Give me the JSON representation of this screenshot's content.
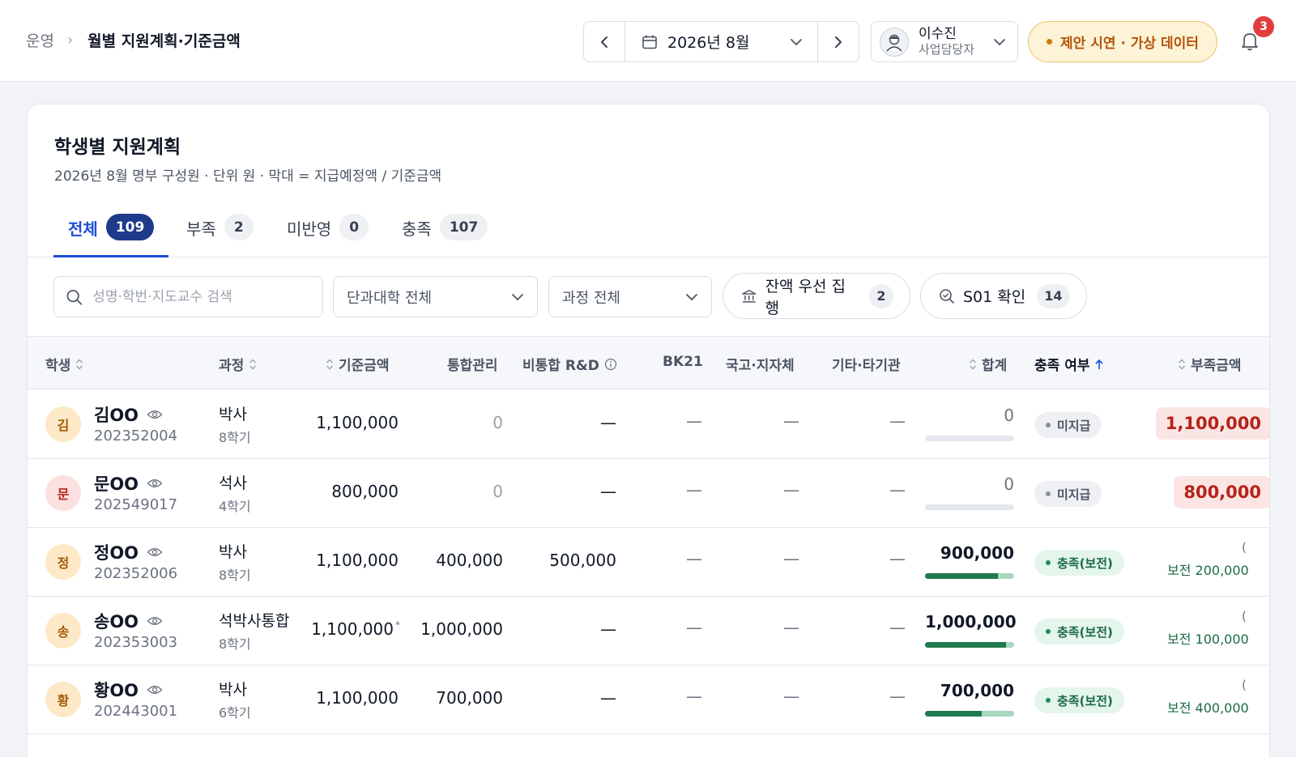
{
  "breadcrumb": {
    "root": "운영",
    "separator": "›",
    "current": "월별 지원계획·기준금액"
  },
  "month_nav": {
    "label": "2026년 8월"
  },
  "user": {
    "name": "이수진",
    "role": "사업담당자"
  },
  "demo_badge": "제안 시연 · 가상 데이터",
  "notifications": {
    "count": "3"
  },
  "card": {
    "title": "학생별 지원계획",
    "subtitle": "2026년 8월 명부 구성원 · 단위 원 · 막대 = 지급예정액 / 기준금액"
  },
  "tabs": [
    {
      "label": "전체",
      "count": "109"
    },
    {
      "label": "부족",
      "count": "2"
    },
    {
      "label": "미반영",
      "count": "0"
    },
    {
      "label": "충족",
      "count": "107"
    }
  ],
  "filters": {
    "search_placeholder": "성명·학번·지도교수 검색",
    "college_select": "단과대학 전체",
    "course_select": "과정 전체",
    "balance_first": {
      "label": "잔액 우선 집행",
      "count": "2"
    },
    "s01_check": {
      "label": "S01 확인",
      "count": "14"
    }
  },
  "columns": {
    "student": "학생",
    "course": "과정",
    "base": "기준금액",
    "integrated": "통합관리",
    "non_rd": "비통합 R&D",
    "bk21": "BK21",
    "national": "국고·지자체",
    "other": "기타·타기관",
    "total": "합계",
    "status": "충족 여부",
    "shortfall": "부족금액"
  },
  "rows": [
    {
      "initial": "김",
      "name": "김OO",
      "id": "202352004",
      "course": "박사",
      "semester": "8학기",
      "base": "1,100,000",
      "base_note": "",
      "integrated": "0",
      "non_rd": "—",
      "bk21": "—",
      "national": "—",
      "other": "—",
      "total": "0",
      "progress": 0,
      "status": "미지급",
      "shortfall": "1,100,000",
      "reserve": ""
    },
    {
      "initial": "문",
      "name": "문OO",
      "id": "202549017",
      "course": "석사",
      "semester": "4학기",
      "base": "800,000",
      "base_note": "",
      "integrated": "0",
      "non_rd": "—",
      "bk21": "—",
      "national": "—",
      "other": "—",
      "total": "0",
      "progress": 0,
      "status": "미지급",
      "shortfall": "800,000",
      "reserve": ""
    },
    {
      "initial": "정",
      "name": "정OO",
      "id": "202352006",
      "course": "박사",
      "semester": "8학기",
      "base": "1,100,000",
      "base_note": "",
      "integrated": "400,000",
      "non_rd": "500,000",
      "bk21": "—",
      "national": "—",
      "other": "—",
      "total": "900,000",
      "progress": 0.82,
      "status": "충족(보전)",
      "shortfall": "(",
      "reserve": "보전 200,000"
    },
    {
      "initial": "송",
      "name": "송OO",
      "id": "202353003",
      "course": "석박사통합",
      "semester": "8학기",
      "base": "1,100,000",
      "base_note": "*",
      "integrated": "1,000,000",
      "non_rd": "—",
      "bk21": "—",
      "national": "—",
      "other": "—",
      "total": "1,000,000",
      "progress": 0.91,
      "status": "충족(보전)",
      "shortfall": "(",
      "reserve": "보전 100,000"
    },
    {
      "initial": "황",
      "name": "황OO",
      "id": "202443001",
      "course": "박사",
      "semester": "6학기",
      "base": "1,100,000",
      "base_note": "",
      "integrated": "700,000",
      "non_rd": "—",
      "bk21": "—",
      "national": "—",
      "other": "—",
      "total": "700,000",
      "progress": 0.64,
      "status": "충족(보전)",
      "shortfall": "(",
      "reserve": "보전 400,000"
    }
  ],
  "colors": {
    "accent": "#1d4ed8",
    "warning_bg": "#fdf3d6",
    "danger": "#b42318",
    "success": "#1b6b44"
  }
}
